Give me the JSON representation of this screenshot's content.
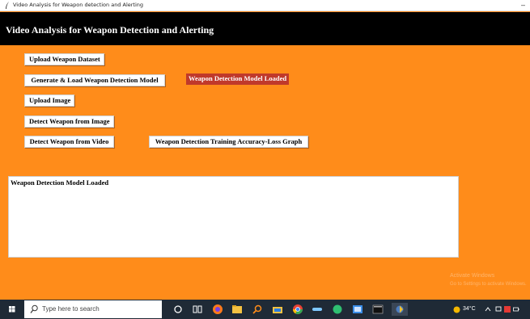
{
  "window": {
    "title": "Video Analysis for Weapon detection and Alerting",
    "minimize_glyph": "–"
  },
  "header": {
    "heading": "Video Analysis for Weapon Detection and Alerting"
  },
  "buttons": {
    "upload_dataset": "Upload Weapon Dataset",
    "generate_model": "Generate & Load Weapon Detection Model",
    "upload_image": "Upload Image",
    "detect_image": "Detect Weapon from Image",
    "detect_video": "Detect Weapon from Video",
    "graph": "Weapon Detection Training Accuracy-Loss Graph"
  },
  "status_label": "Weapon Detection Model Loaded",
  "output": {
    "text": "Weapon Detection Model Loaded"
  },
  "watermark": {
    "line1": "Activate Windows",
    "line2": "Go to Settings to activate Windows."
  },
  "taskbar": {
    "search_placeholder": "Type here to search",
    "temperature": "34°C",
    "colors": {
      "background": "#1f2a36",
      "accent": "#ff8c1a"
    }
  }
}
